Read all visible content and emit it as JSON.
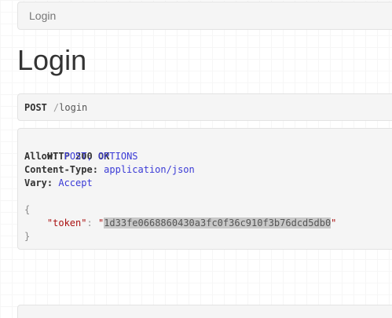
{
  "breadcrumb": {
    "current": "Login"
  },
  "page": {
    "title": "Login"
  },
  "request": {
    "method": "POST",
    "separator": "/",
    "path": "login"
  },
  "response": {
    "status": "HTTP 200 OK",
    "headers": [
      {
        "key": "Allow:",
        "value": "POST, OPTIONS"
      },
      {
        "key": "Content-Type:",
        "value": "application/json"
      },
      {
        "key": "Vary:",
        "value": "Accept"
      }
    ],
    "body": {
      "open_brace": "{",
      "close_brace": "}",
      "key": "\"token\"",
      "colon": ":",
      "quote": "\"",
      "value": "1d33fe0668860430a3fc0f36c910f3b76dcd5db0"
    }
  }
}
